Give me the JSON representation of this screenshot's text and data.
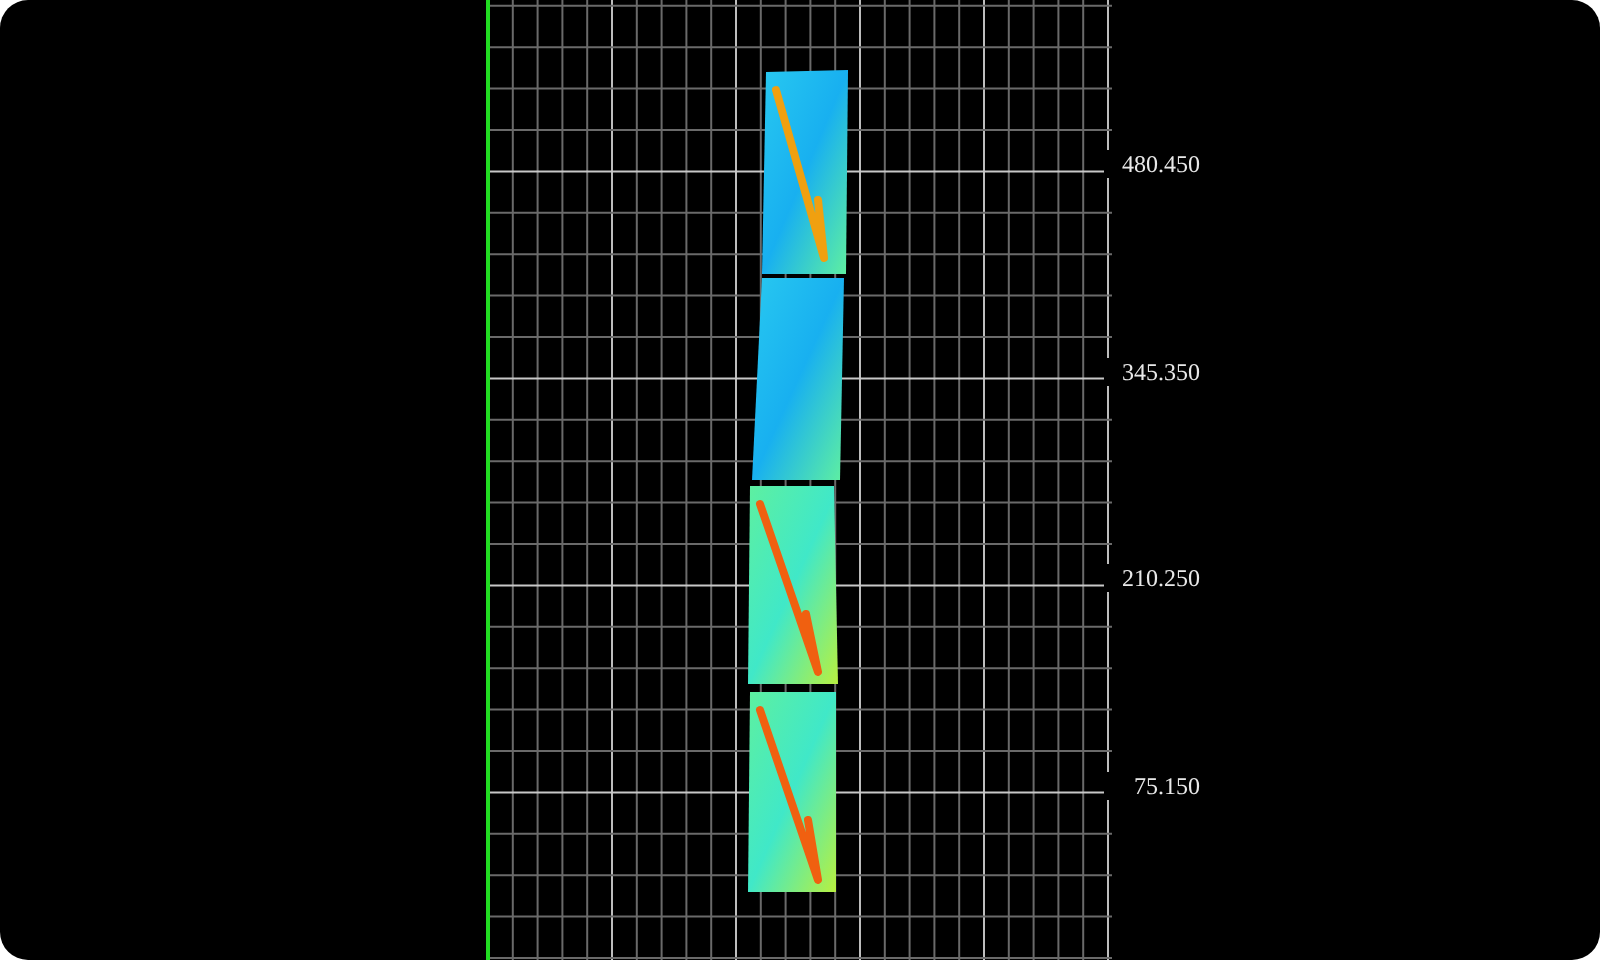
{
  "view": {
    "axis_labels": [
      "480.450",
      "345.350",
      "210.250",
      "75.150"
    ]
  }
}
